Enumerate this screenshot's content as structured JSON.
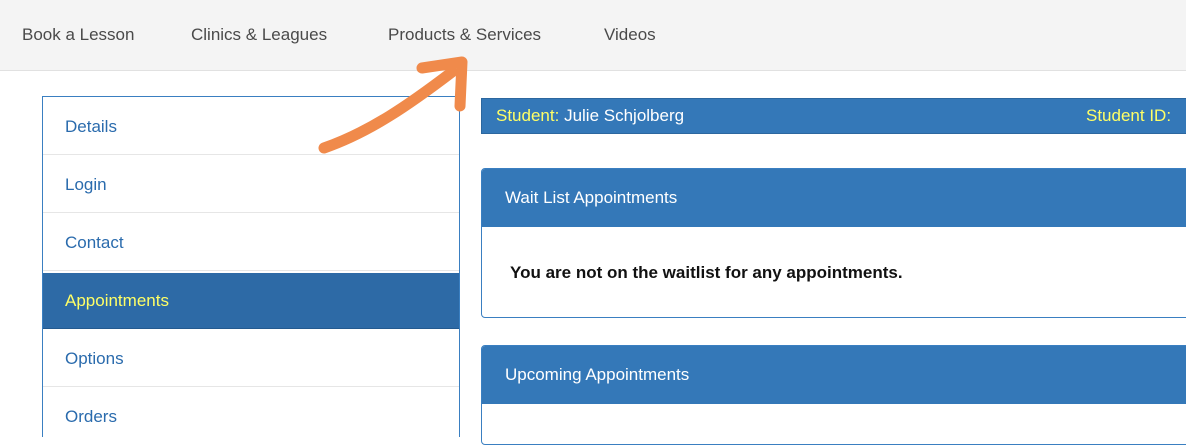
{
  "topnav": {
    "items": [
      {
        "label": "Book a Lesson"
      },
      {
        "label": "Clinics & Leagues"
      },
      {
        "label": "Products & Services"
      },
      {
        "label": "Videos"
      }
    ]
  },
  "sidebar": {
    "items": [
      {
        "label": "Details"
      },
      {
        "label": "Login"
      },
      {
        "label": "Contact"
      },
      {
        "label": "Appointments",
        "active": true
      },
      {
        "label": "Options"
      },
      {
        "label": "Orders"
      }
    ]
  },
  "student_bar": {
    "student_label": "Student:",
    "student_name": "Julie Schjolberg",
    "id_label": "Student ID:"
  },
  "wait_list": {
    "title": "Wait List Appointments",
    "message": "You are not on the waitlist for any appointments."
  },
  "upcoming": {
    "title": "Upcoming Appointments"
  },
  "colors": {
    "accent": "#3478b8",
    "highlight_text": "#ffff66",
    "annotation_arrow": "#f08a4b"
  },
  "annotation": {
    "icon": "arrow-icon"
  }
}
